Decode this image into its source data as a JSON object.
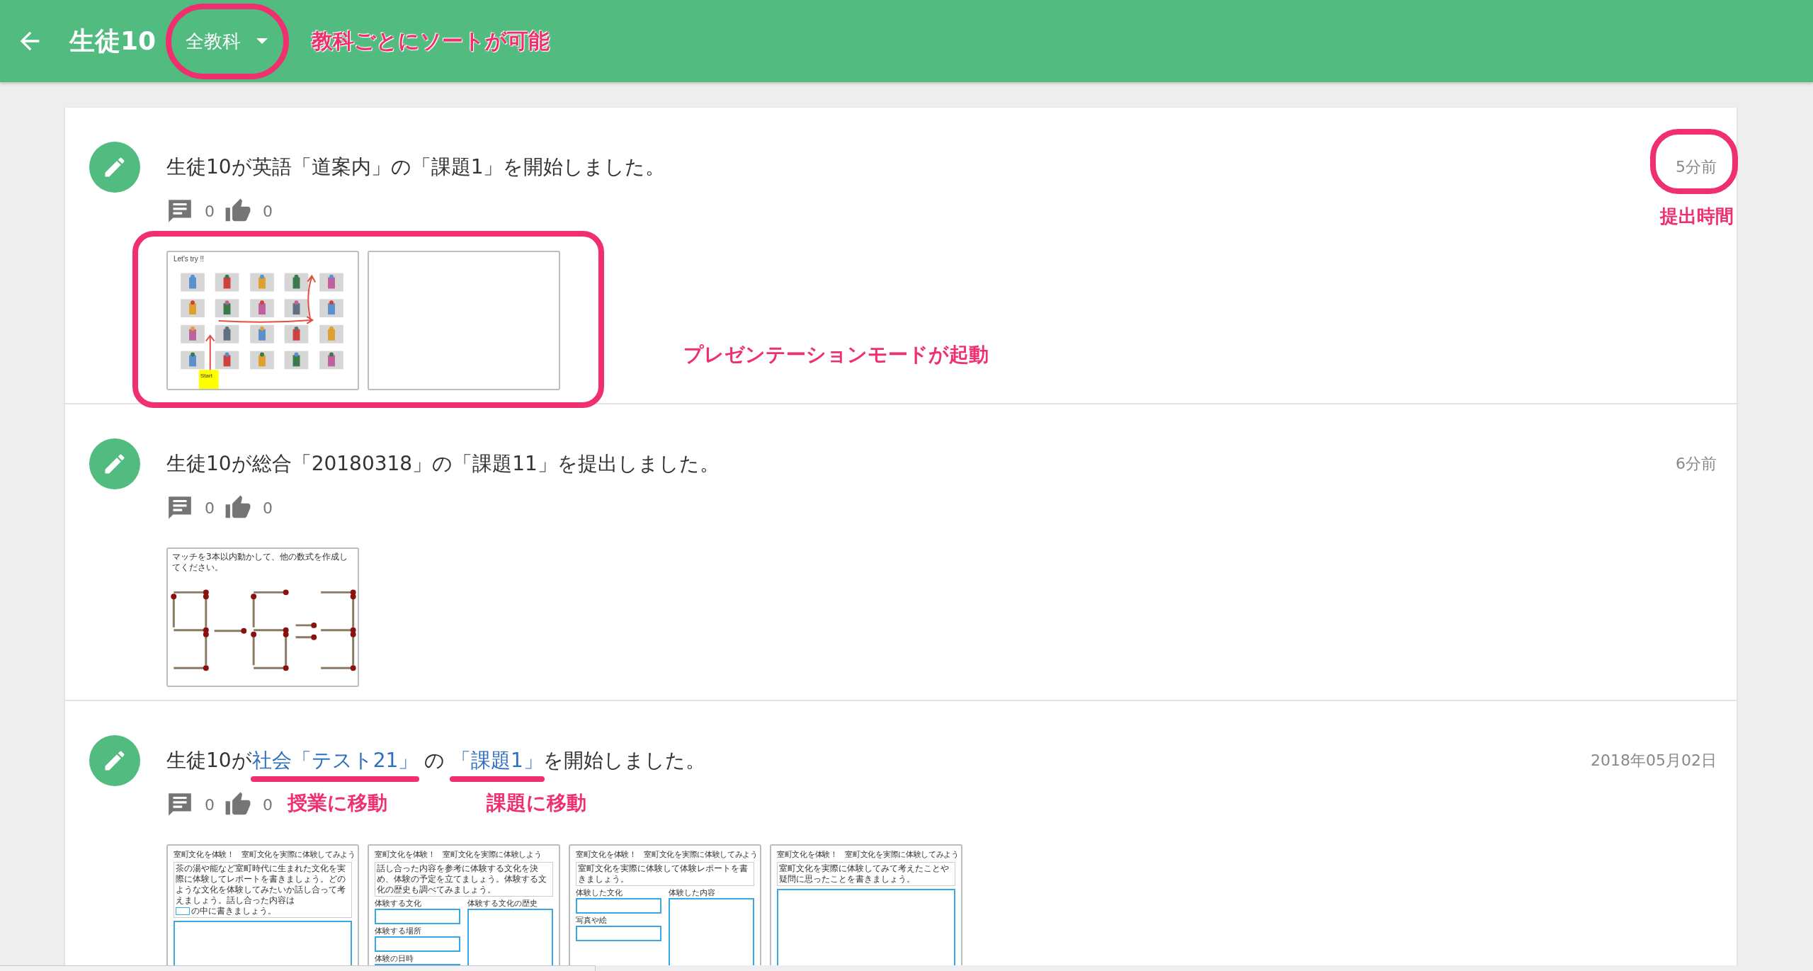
{
  "header": {
    "title": "生徒10",
    "filter": {
      "label": "全教科",
      "note": "教科ごとにソートが可能"
    }
  },
  "items": [
    {
      "message": [
        {
          "kind": "text",
          "text": "生徒10が英語「道案内」の「課題1」を開始しました。"
        }
      ],
      "time": "5分前",
      "time_note": "提出時間",
      "comments": "0",
      "likes": "0",
      "thumbnails_note": "プレゼンテーションモードが起動",
      "thumbnails": [
        {
          "kind": "map",
          "title": "Let's try !!",
          "start": "Start"
        },
        {
          "kind": "blank"
        }
      ]
    },
    {
      "message": [
        {
          "kind": "text",
          "text": "生徒10が総合「20180318」の「課題11」を提出しました。"
        }
      ],
      "time": "6分前",
      "comments": "0",
      "likes": "0",
      "thumbnails": [
        {
          "kind": "matchsticks",
          "caption": "マッチを3本以内動かして、他の数式を作成してください。"
        }
      ]
    },
    {
      "message": [
        {
          "kind": "text",
          "text": "生徒10が"
        },
        {
          "kind": "link",
          "text": "社会「テスト21」",
          "note": "授業に移動"
        },
        {
          "kind": "text",
          "text": " の "
        },
        {
          "kind": "link",
          "text": "「課題1」",
          "note": "課題に移動"
        },
        {
          "kind": "text",
          "text": "を開始しました。"
        }
      ],
      "time": "2018年05月02日",
      "comments": "0",
      "likes": "0",
      "thumbnails": [
        {
          "kind": "worksheet",
          "title": "室町文化を体験！　室町文化を実際に体験してみよう",
          "text": "茶の湯や能など室町時代に生まれた文化を実際に体験してレポートを書きましょう。どのような文化を体験してみたいか話し合って考えましょう。話し合った内容は",
          "text_after": "の中に書きましょう。"
        },
        {
          "kind": "worksheet",
          "title": "室町文化を体験！　室町文化を実際に体験しよう",
          "text": "話し合った内容を参考に体験する文化を決め、体験の予定を立てましょう。体験する文化の歴史も調べてみましょう。",
          "left": [
            "体験する文化",
            "体験する場所",
            "体験の日時"
          ],
          "right": [
            "体験する文化の歴史"
          ]
        },
        {
          "kind": "worksheet",
          "title": "室町文化を体験！　室町文化を実際に体験してみよう",
          "text": "室町文化を実際に体験して体験レポートを書きましょう。",
          "left": [
            "体験した文化",
            "写真や絵"
          ],
          "right": [
            "体験した内容"
          ]
        },
        {
          "kind": "worksheet",
          "title": "室町文化を体験！　室町文化を実際に体験してみよう",
          "text": "室町文化を実際に体験してみて考えたことや疑問に思ったことを書きましょう。"
        }
      ]
    }
  ]
}
